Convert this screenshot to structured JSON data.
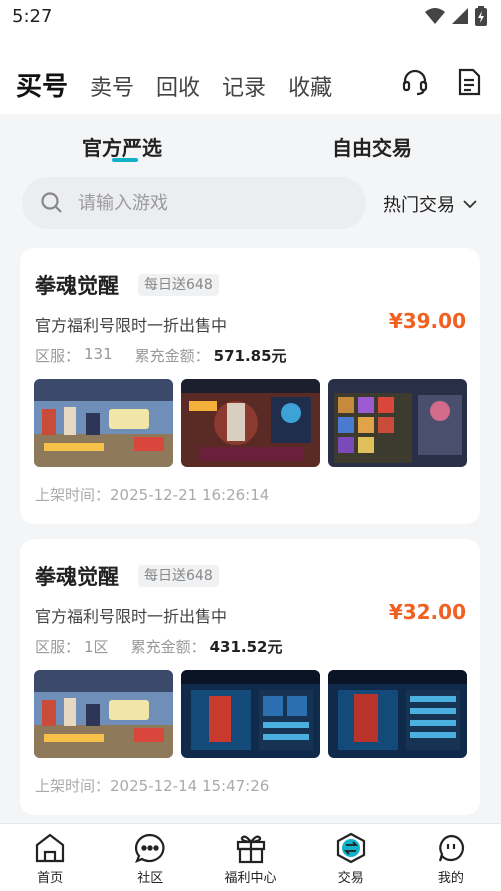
{
  "status_bar": {
    "time": "5:27"
  },
  "top_nav": {
    "tabs": [
      {
        "label": "买号",
        "active": true
      },
      {
        "label": "卖号"
      },
      {
        "label": "回收"
      },
      {
        "label": "记录"
      },
      {
        "label": "收藏"
      }
    ],
    "right_icons": [
      "headset-icon",
      "document-icon"
    ]
  },
  "sub_tabs": [
    {
      "label": "官方严选",
      "active": true
    },
    {
      "label": "自由交易"
    }
  ],
  "search": {
    "placeholder": "请输入游戏"
  },
  "filter": {
    "label": "热门交易"
  },
  "listings": [
    {
      "title": "拳魂觉醒",
      "badge": "每日送648",
      "desc": "官方福利号限时一折出售中",
      "price": "¥39.00",
      "server_label": "区服：",
      "server": "131",
      "recharge_label": "累充金额：",
      "recharge": "571.85元",
      "listed": "上架时间：2025-12-21 16:26:14"
    },
    {
      "title": "拳魂觉醒",
      "badge": "每日送648",
      "desc": "官方福利号限时一折出售中",
      "price": "¥32.00",
      "server_label": "区服：",
      "server": "1区",
      "recharge_label": "累充金额：",
      "recharge": "431.52元",
      "listed": "上架时间：2025-12-14 15:47:26"
    }
  ],
  "bottom_nav": [
    {
      "label": "首页",
      "icon": "home-icon"
    },
    {
      "label": "社区",
      "icon": "chat-icon"
    },
    {
      "label": "福利中心",
      "icon": "gift-icon"
    },
    {
      "label": "交易",
      "icon": "trade-icon"
    },
    {
      "label": "我的",
      "icon": "profile-icon"
    }
  ],
  "colors": {
    "accent": "#12b3c9",
    "price": "#f06021"
  }
}
